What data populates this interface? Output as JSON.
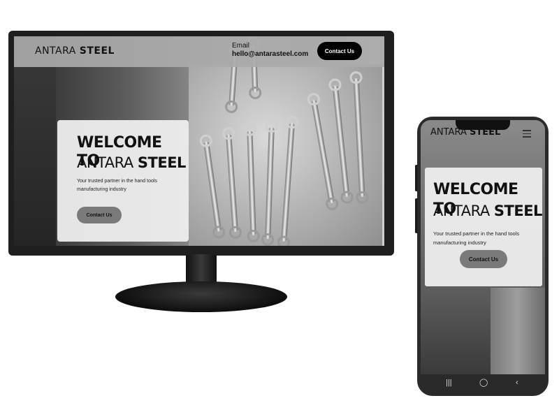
{
  "brand": {
    "name_light": "ANTARA ",
    "name_bold": "STEEL"
  },
  "header": {
    "email_label": "Email",
    "email_value": "hello@antarasteel.com",
    "contact_button": "Contact Us"
  },
  "hero": {
    "line1": "WELCOME TO",
    "line2_light": "ANTARA ",
    "line2_bold": "STEEL",
    "tagline": "Your trusted partner in the hand tools manufacturing industry",
    "cta": "Contact Us"
  },
  "phone_nav": {
    "recent_icon": "recent-apps-icon",
    "home_icon": "home-icon",
    "back_icon": "back-icon"
  }
}
